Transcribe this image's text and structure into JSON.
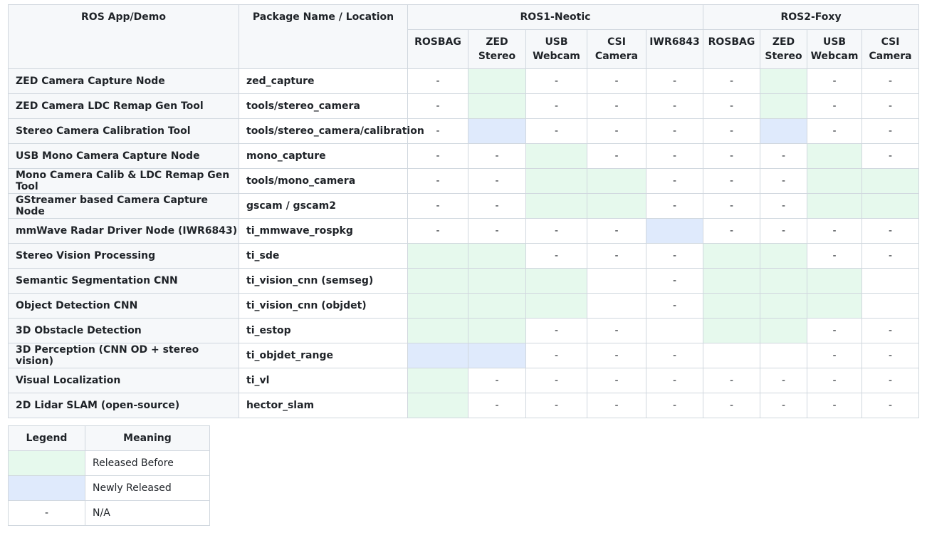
{
  "header": {
    "app": "ROS App/Demo",
    "pkg": "Package Name / Location",
    "groups": [
      "ROS1-Neotic",
      "ROS2-Foxy"
    ],
    "cols": [
      [
        "ROSBAG"
      ],
      [
        "ZED",
        "Stereo"
      ],
      [
        "USB",
        "Webcam"
      ],
      [
        "CSI",
        "Camera"
      ],
      [
        "IWR6843"
      ],
      [
        "ROSBAG"
      ],
      [
        "ZED",
        "Stereo"
      ],
      [
        "USB",
        "Webcam"
      ],
      [
        "CSI",
        "Camera"
      ]
    ]
  },
  "rows": [
    {
      "app": "ZED Camera Capture Node",
      "pkg": "zed_capture",
      "cells": [
        "-",
        "g",
        "-",
        "-",
        "-",
        "-",
        "g",
        "-",
        "-"
      ]
    },
    {
      "app": "ZED Camera LDC Remap Gen Tool",
      "pkg": "tools/stereo_camera",
      "cells": [
        "-",
        "g",
        "-",
        "-",
        "-",
        "-",
        "g",
        "-",
        "-"
      ]
    },
    {
      "app": "Stereo Camera Calibration Tool",
      "pkg": "tools/stereo_camera/calibration",
      "cells": [
        "-",
        "b",
        "-",
        "-",
        "-",
        "-",
        "b",
        "-",
        "-"
      ]
    },
    {
      "app": "USB Mono Camera Capture Node",
      "pkg": "mono_capture",
      "cells": [
        "-",
        "-",
        "g",
        "-",
        "-",
        "-",
        "-",
        "g",
        "-"
      ]
    },
    {
      "app": "Mono Camera Calib & LDC Remap Gen Tool",
      "pkg": "tools/mono_camera",
      "cells": [
        "-",
        "-",
        "g",
        "g",
        "-",
        "-",
        "-",
        "g",
        "g"
      ]
    },
    {
      "app": "GStreamer based Camera Capture Node",
      "pkg": "gscam / gscam2",
      "cells": [
        "-",
        "-",
        "g",
        "g",
        "-",
        "-",
        "-",
        "g",
        "g"
      ]
    },
    {
      "app": "mmWave Radar Driver Node (IWR6843)",
      "pkg": "ti_mmwave_rospkg",
      "cells": [
        "-",
        "-",
        "-",
        "-",
        "b",
        "-",
        "-",
        "-",
        "-"
      ]
    },
    {
      "app": "Stereo Vision Processing",
      "pkg": "ti_sde",
      "cells": [
        "g",
        "g",
        "-",
        "-",
        "-",
        "g",
        "g",
        "-",
        "-"
      ]
    },
    {
      "app": "Semantic Segmentation CNN",
      "pkg": "ti_vision_cnn (semseg)",
      "cells": [
        "g",
        "g",
        "g",
        "",
        "-",
        "g",
        "g",
        "g",
        ""
      ]
    },
    {
      "app": "Object Detection CNN",
      "pkg": "ti_vision_cnn (objdet)",
      "cells": [
        "g",
        "g",
        "g",
        "",
        "-",
        "g",
        "g",
        "g",
        ""
      ]
    },
    {
      "app": "3D Obstacle Detection",
      "pkg": "ti_estop",
      "cells": [
        "g",
        "g",
        "-",
        "-",
        "",
        "g",
        "g",
        "-",
        "-"
      ]
    },
    {
      "app": "3D Perception (CNN OD + stereo vision)",
      "pkg": "ti_objdet_range",
      "cells": [
        "b",
        "b",
        "-",
        "-",
        "-",
        "",
        "",
        "-",
        "-"
      ]
    },
    {
      "app": "Visual Localization",
      "pkg": "ti_vl",
      "cells": [
        "g",
        "-",
        "-",
        "-",
        "-",
        "-",
        "-",
        "-",
        "-"
      ]
    },
    {
      "app": "2D Lidar SLAM (open-source)",
      "pkg": "hector_slam",
      "cells": [
        "g",
        "-",
        "-",
        "-",
        "-",
        "-",
        "-",
        "-",
        "-"
      ]
    }
  ],
  "legend": {
    "header": [
      "Legend",
      "Meaning"
    ],
    "items": [
      {
        "swatch": "g",
        "symbol": "",
        "meaning": "Released Before"
      },
      {
        "swatch": "b",
        "symbol": "",
        "meaning": "Newly Released"
      },
      {
        "swatch": "",
        "symbol": "-",
        "meaning": "N/A"
      }
    ]
  },
  "colors": {
    "released_before": "#e6f9ed",
    "newly_released": "#dfeafc",
    "header_bg": "#f6f8fa",
    "border": "#d0d7de"
  }
}
